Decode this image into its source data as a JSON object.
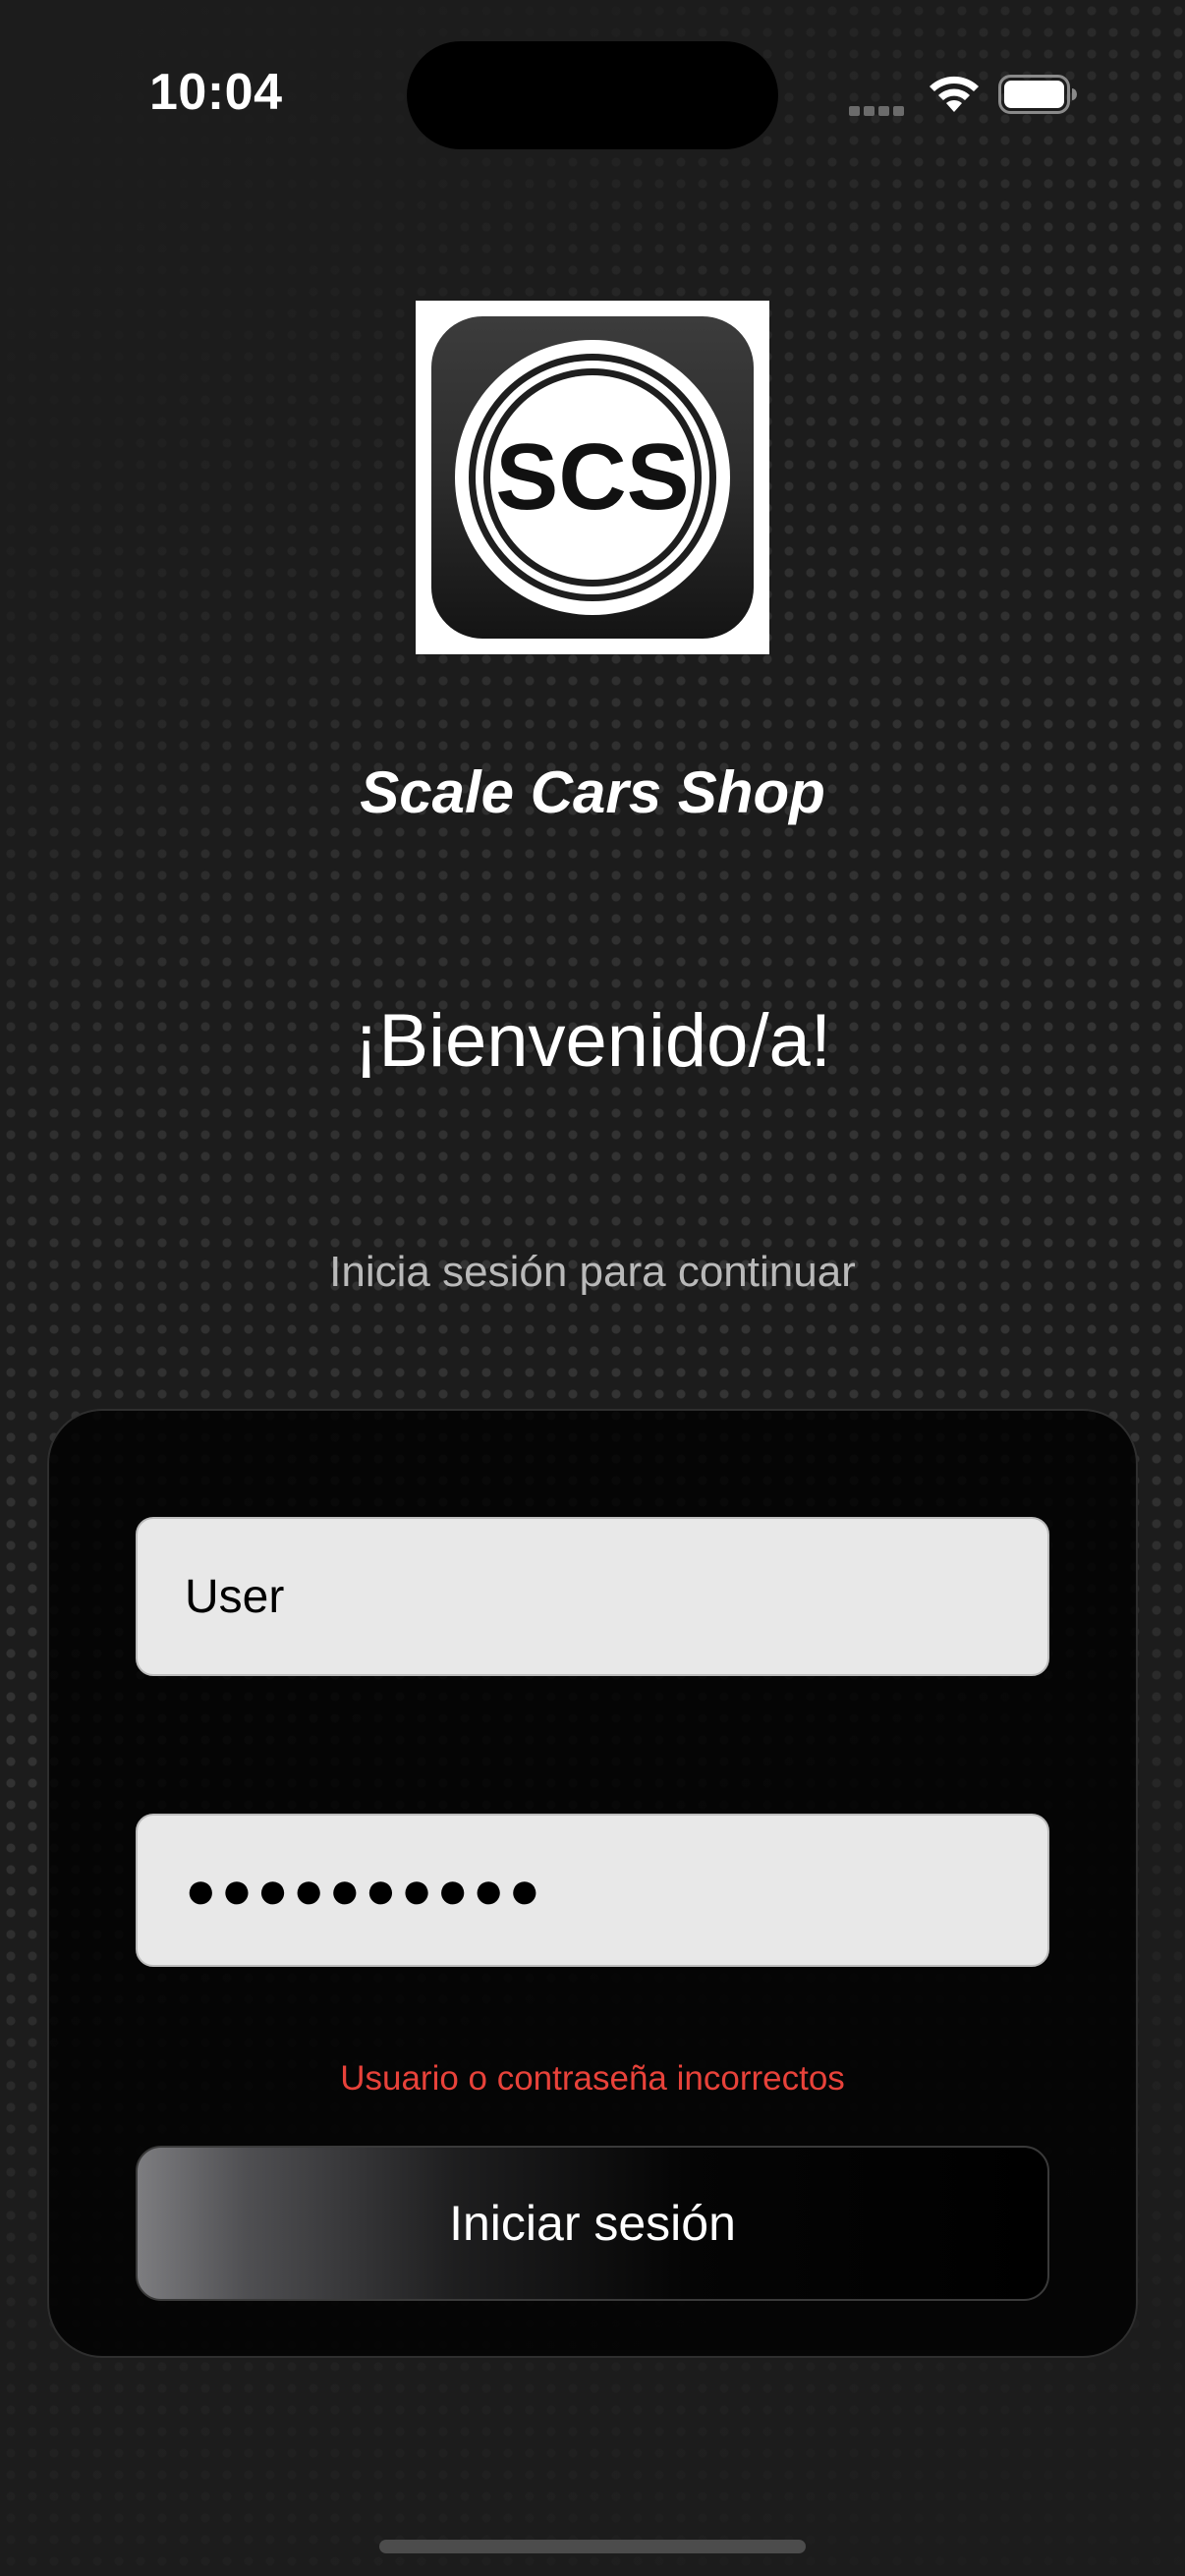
{
  "status_bar": {
    "time": "10:04"
  },
  "logo": {
    "text": "SCS",
    "title": "Scale Cars Shop"
  },
  "header": {
    "welcome": "¡Bienvenido/a!",
    "subtitle": "Inicia sesión para continuar"
  },
  "login_form": {
    "username_value": "User",
    "password_value": "●●●●●●●●●●",
    "error_message": "Usuario o contraseña incorrectos",
    "submit_label": "Iniciar sesión"
  },
  "colors": {
    "background": "#1c1c1c",
    "error": "#e8423a",
    "field_background": "#e8e8e8"
  }
}
